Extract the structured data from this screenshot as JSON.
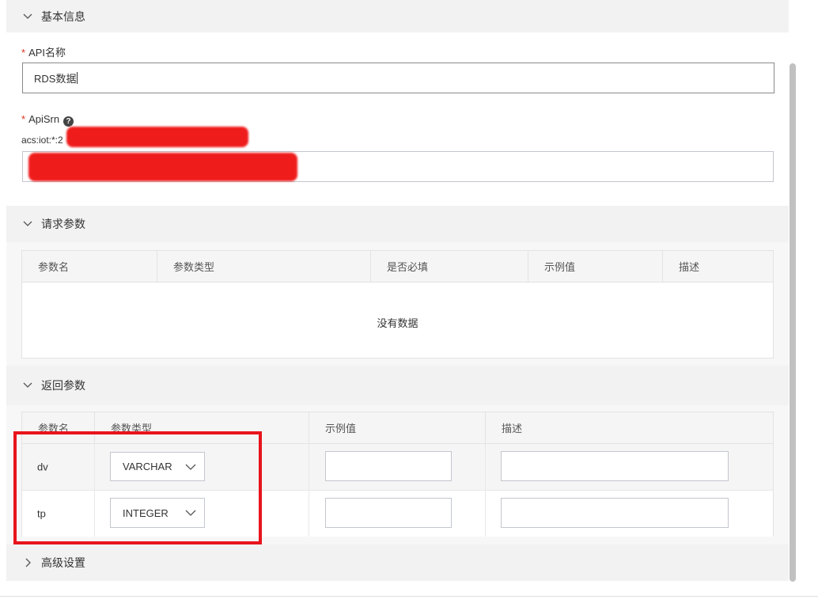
{
  "basic_info": {
    "title": "基本信息",
    "api_name_label": "API名称",
    "api_name_value": "RDS数据",
    "api_srn_label": "ApiSrn",
    "api_srn_prefix": "acs:iot:*:2",
    "required_mark": "*",
    "help_glyph": "?"
  },
  "request_params": {
    "title": "请求参数",
    "columns": [
      "参数名",
      "参数类型",
      "是否必填",
      "示例值",
      "描述"
    ],
    "empty_text": "没有数据"
  },
  "response_params": {
    "title": "返回参数",
    "columns": [
      "参数名",
      "参数类型",
      "示例值",
      "描述"
    ],
    "rows": [
      {
        "name": "dv",
        "type": "VARCHAR",
        "example": "",
        "description": ""
      },
      {
        "name": "tp",
        "type": "INTEGER",
        "example": "",
        "description": ""
      }
    ]
  },
  "advanced": {
    "title": "高级设置"
  },
  "colors": {
    "required": "#e0301e",
    "highlight_box": "#e8141c",
    "redaction": "#ef1c1c"
  },
  "icons": {
    "expanded": "chevron-down-icon",
    "collapsed": "chevron-right-icon",
    "help": "question-circle-icon",
    "select": "chevron-down-icon"
  }
}
